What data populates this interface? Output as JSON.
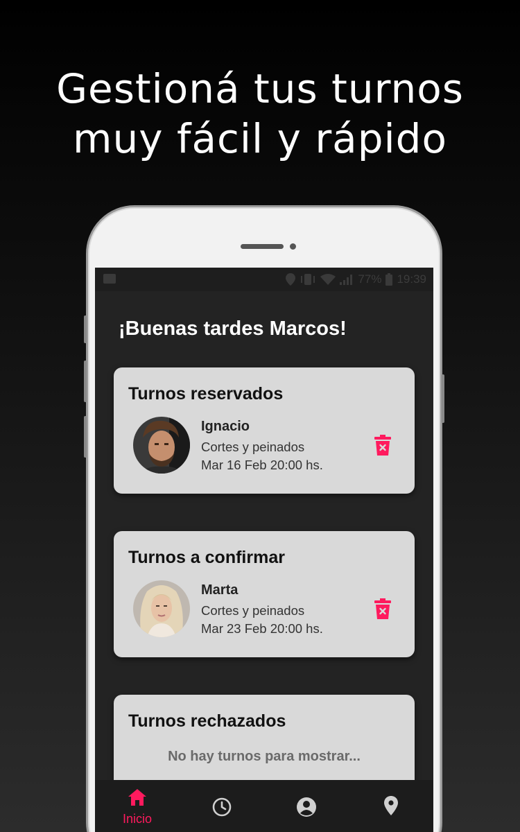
{
  "headline": {
    "line1": "Gestioná tus turnos",
    "line2": "muy fácil y rápido"
  },
  "statusbar": {
    "battery": "77%",
    "time": "19:39"
  },
  "greeting": "¡Buenas tardes Marcos!",
  "cards": {
    "reserved": {
      "title": "Turnos reservados",
      "name": "Ignacio",
      "service": "Cortes y peinados",
      "datetime": "Mar 16 Feb 20:00 hs."
    },
    "pending": {
      "title": "Turnos a confirmar",
      "name": "Marta",
      "service": "Cortes y peinados",
      "datetime": "Mar 23 Feb 20:00 hs."
    },
    "rejected": {
      "title": "Turnos rechazados",
      "empty_message": "No hay turnos para mostrar..."
    }
  },
  "bottom_nav": {
    "items": [
      {
        "label": "Inicio",
        "icon": "home-icon",
        "active": true
      },
      {
        "label": "",
        "icon": "clock-icon",
        "active": false
      },
      {
        "label": "",
        "icon": "account-icon",
        "active": false
      },
      {
        "label": "",
        "icon": "location-pin-icon",
        "active": false
      }
    ]
  },
  "colors": {
    "accent": "#ff1a5e",
    "card_bg": "#d9d9d9",
    "screen_bg": "#232323",
    "nav_icon": "#d0d0d0"
  }
}
